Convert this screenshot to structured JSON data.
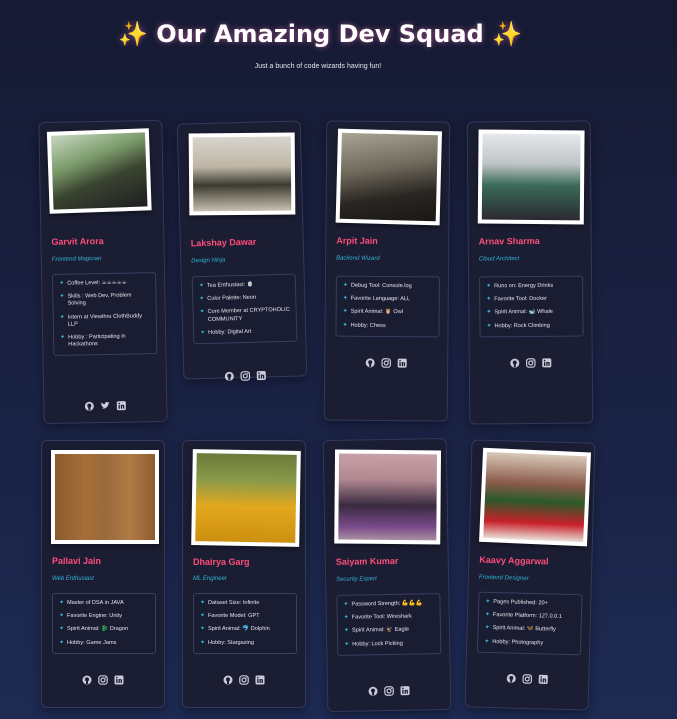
{
  "header": {
    "title": "✨ Our Amazing Dev Squad ✨",
    "subtitle": "Just a bunch of code wizards having fun!"
  },
  "icons": [
    "github-icon",
    "twitter-icon",
    "instagram-icon",
    "linkedin-icon"
  ],
  "colors": {
    "name": "#ff4d7a",
    "role": "#2fb6d6",
    "card_bg": "#1b1d33"
  },
  "members": [
    {
      "name": "Garvit Arora",
      "role": "Frontend Magician",
      "facts": [
        "Coffee Level: ☕☕☕☕☕",
        "Skills : Web Dev, Problem Solving",
        "Intern at Viewthru ClothBuddy LLP",
        "Hobby : Participating in Hackathons"
      ],
      "socials": [
        "github",
        "twitter",
        "linkedin"
      ]
    },
    {
      "name": "Lakshay Dawar",
      "role": "Design Ninja",
      "facts": [
        "Tea Enthusiast: 🍵",
        "Color Palette: Neon",
        "Core Member at CRYPTOHOLIC COMMUNITY",
        "Hobby: Digital Art"
      ],
      "socials": [
        "github",
        "instagram",
        "linkedin"
      ]
    },
    {
      "name": "Arpit Jain",
      "role": "Backend Wizard",
      "facts": [
        "Debug Tool: Console.log",
        "Favorite Language: ALL",
        "Spirit Animal: 🦉 Owl",
        "Hobby: Chess"
      ],
      "socials": [
        "github",
        "instagram",
        "linkedin"
      ]
    },
    {
      "name": "Arnav Sharma",
      "role": "Cloud Architect",
      "facts": [
        "Runs on: Energy Drinks",
        "Favorite Tool: Docker",
        "Spirit Animal: 🐋 Whale",
        "Hobby: Rock Climbing"
      ],
      "socials": [
        "github",
        "instagram",
        "linkedin"
      ]
    },
    {
      "name": "Pallavi Jain",
      "role": "Web Enthusiast",
      "facts": [
        "Master of DSA in JAVA",
        "Favorite Engine: Unity",
        "Spirit Animal: 🐉 Dragon",
        "Hobby: Game Jams"
      ],
      "socials": [
        "github",
        "instagram",
        "linkedin"
      ]
    },
    {
      "name": "Dhairya Garg",
      "role": "ML Engineer",
      "facts": [
        "Dataset Size: Infinite",
        "Favorite Model: GPT",
        "Spirit Animal: 🐬 Dolphin",
        "Hobby: Stargazing"
      ],
      "socials": [
        "github",
        "instagram",
        "linkedin"
      ]
    },
    {
      "name": "Saiyam Kumar",
      "role": "Security Expert",
      "facts": [
        "Password Strength: 💪💪💪",
        "Favorite Tool: Wireshark",
        "Spirit Animal: 🦅 Eagle",
        "Hobby: Lock Picking"
      ],
      "socials": [
        "github",
        "instagram",
        "linkedin"
      ]
    },
    {
      "name": "Kaavy Aggarwal",
      "role": "Frontend Designer",
      "facts": [
        "Pages Published: 20+",
        "Favorite Platform: 127.0.0.1",
        "Spirit Animal: 🦋 Butterfly",
        "Hobby: Photography"
      ],
      "socials": [
        "github",
        "instagram",
        "linkedin"
      ]
    }
  ]
}
